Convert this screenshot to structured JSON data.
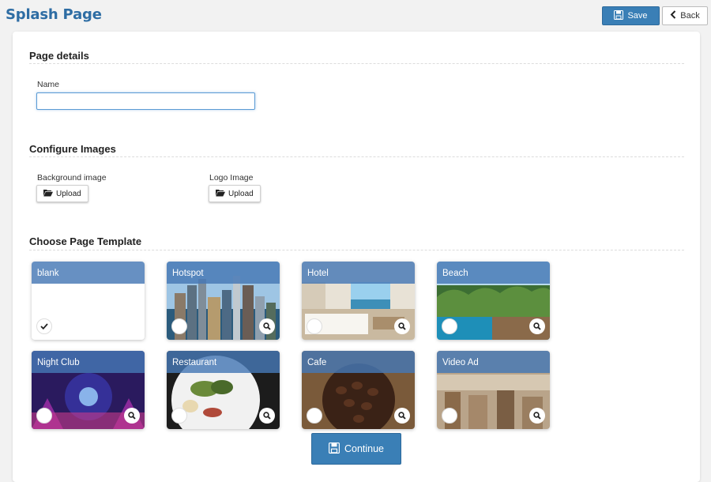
{
  "header": {
    "title": "Splash Page",
    "save_label": "Save",
    "back_label": "Back"
  },
  "page_details": {
    "title": "Page details",
    "name_label": "Name",
    "name_value": ""
  },
  "configure_images": {
    "title": "Configure Images",
    "background_label": "Background image",
    "logo_label": "Logo Image",
    "upload_label": "Upload"
  },
  "templates": {
    "title": "Choose Page Template",
    "selected": "blank",
    "items": [
      {
        "label": "blank",
        "icon": "checkmark-icon"
      },
      {
        "label": "Hotspot",
        "icon": "magnifier-icon"
      },
      {
        "label": "Hotel",
        "icon": "magnifier-icon"
      },
      {
        "label": "Beach",
        "icon": "magnifier-icon"
      },
      {
        "label": "Night Club",
        "icon": "magnifier-icon"
      },
      {
        "label": "Restaurant",
        "icon": "magnifier-icon"
      },
      {
        "label": "Cafe",
        "icon": "magnifier-icon"
      },
      {
        "label": "Video Ad",
        "icon": "magnifier-icon"
      }
    ]
  },
  "footer": {
    "continue_label": "Continue"
  },
  "colors": {
    "accent": "#3a7fb6",
    "title": "#2e6da4",
    "card_band": "#4678b4"
  }
}
